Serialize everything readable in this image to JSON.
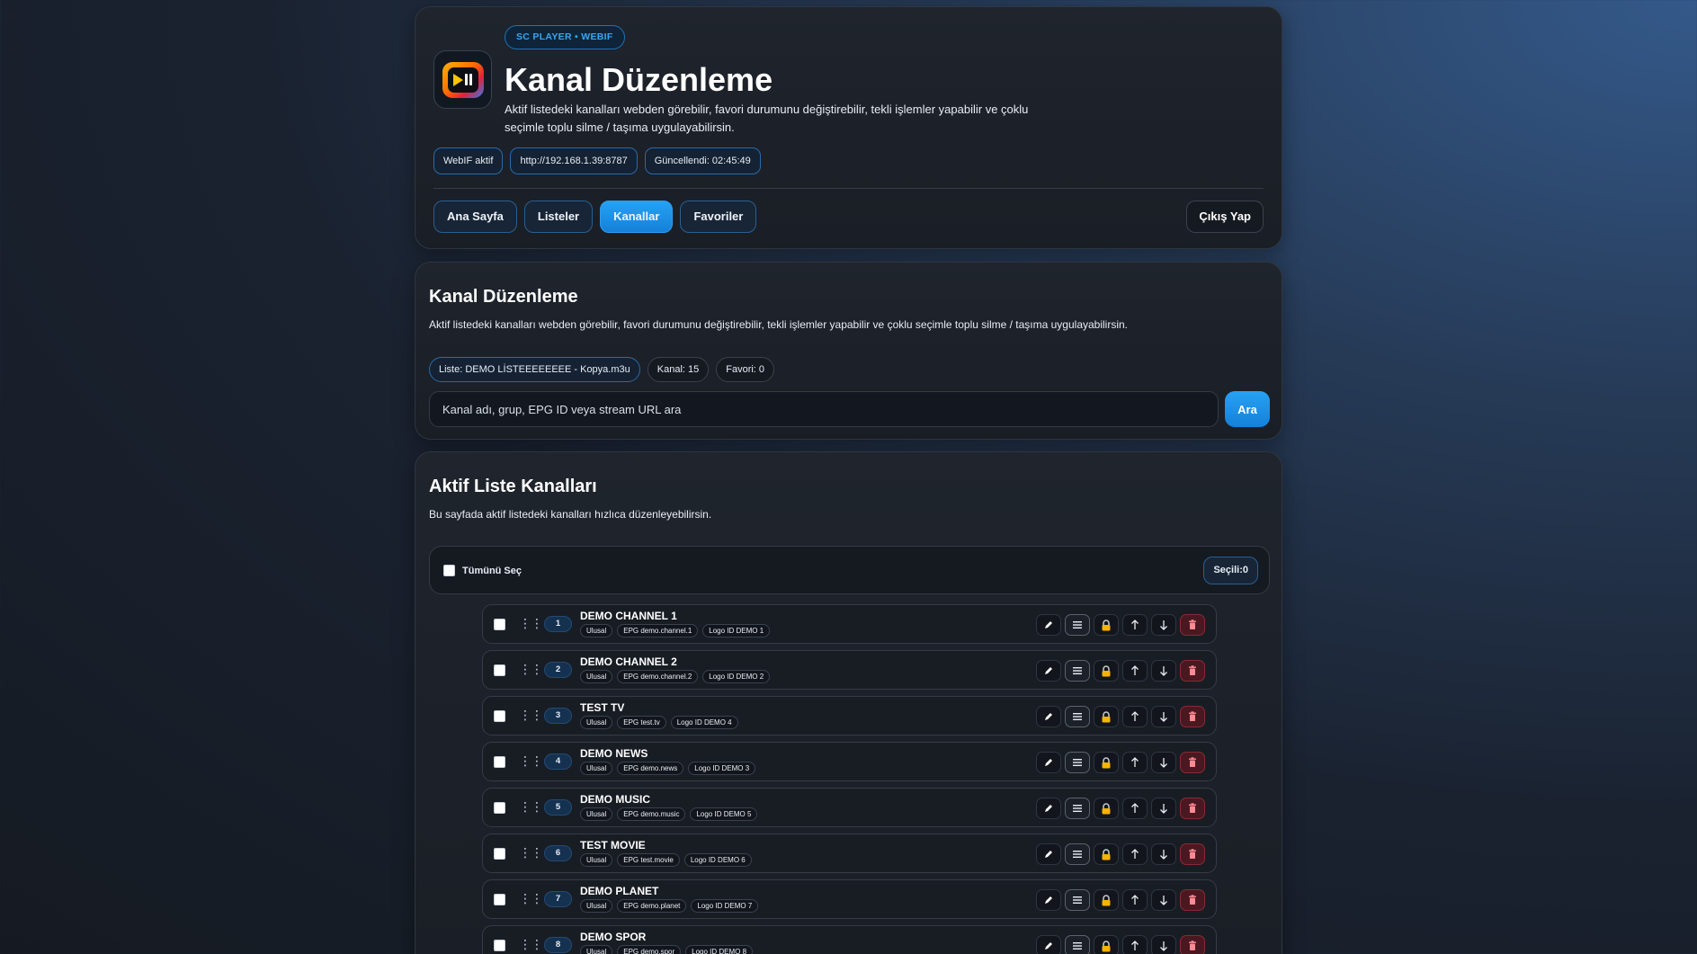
{
  "header": {
    "badge": "SC PLAYER • WEBIF",
    "title": "Kanal Düzenleme",
    "description": "Aktif listedeki kanalları webden görebilir, favori durumunu değiştirebilir, tekli işlemler yapabilir ve çoklu seçimle toplu silme / taşıma uygulayabilirsin.",
    "chips": [
      "WebIF aktif",
      "http://192.168.1.39:8787",
      "Güncellendi: 02:45:49"
    ],
    "nav": [
      {
        "label": "Ana Sayfa",
        "active": false
      },
      {
        "label": "Listeler",
        "active": false
      },
      {
        "label": "Kanallar",
        "active": true
      },
      {
        "label": "Favoriler",
        "active": false
      }
    ],
    "logout_label": "Çıkış Yap"
  },
  "edit": {
    "title": "Kanal Düzenleme",
    "description": "Aktif listedeki kanalları webden görebilir, favori durumunu değiştirebilir, tekli işlemler yapabilir ve çoklu seçimle toplu silme / taşıma uygulayabilirsin.",
    "stats": {
      "list": "Liste: DEMO LİSTEEEEEEEE - Kopya.m3u",
      "channels": "Kanal: 15",
      "favorites": "Favori: 0"
    },
    "search_placeholder": "Kanal adı, grup, EPG ID veya stream URL ara",
    "search_button": "Ara"
  },
  "list": {
    "title": "Aktif Liste Kanalları",
    "description": "Bu sayfada aktif listedeki kanalları hızlıca düzenleyebilirsin.",
    "select_all_label": "Tümünü Seç",
    "selected_label": "Seçili:0",
    "channels": [
      {
        "no": "1",
        "name": "DEMO CHANNEL 1",
        "group": "Ulusal",
        "epg": "EPG demo.channel.1",
        "logo": "Logo ID DEMO 1"
      },
      {
        "no": "2",
        "name": "DEMO CHANNEL 2",
        "group": "Ulusal",
        "epg": "EPG demo.channel.2",
        "logo": "Logo ID DEMO 2"
      },
      {
        "no": "3",
        "name": "TEST TV",
        "group": "Ulusal",
        "epg": "EPG test.tv",
        "logo": "Logo ID DEMO 4"
      },
      {
        "no": "4",
        "name": "DEMO NEWS",
        "group": "Ulusal",
        "epg": "EPG demo.news",
        "logo": "Logo ID DEMO 3"
      },
      {
        "no": "5",
        "name": "DEMO MUSIC",
        "group": "Ulusal",
        "epg": "EPG demo.music",
        "logo": "Logo ID DEMO 5"
      },
      {
        "no": "6",
        "name": "TEST MOVIE",
        "group": "Ulusal",
        "epg": "EPG test.movie",
        "logo": "Logo ID DEMO 6"
      },
      {
        "no": "7",
        "name": "DEMO PLANET",
        "group": "Ulusal",
        "epg": "EPG demo.planet",
        "logo": "Logo ID DEMO 7"
      },
      {
        "no": "8",
        "name": "DEMO SPOR",
        "group": "Ulusal",
        "epg": "EPG demo.spor",
        "logo": "Logo ID DEMO 8"
      }
    ],
    "row_actions": [
      "edit-icon",
      "menu-icon",
      "lock-icon",
      "arrow-up-icon",
      "arrow-down-icon",
      "trash-icon"
    ]
  },
  "colors": {
    "accent": "#1e90ee",
    "badge_text": "#39a6ee",
    "delete": "#8a2a33",
    "lock": "#f5b400"
  }
}
